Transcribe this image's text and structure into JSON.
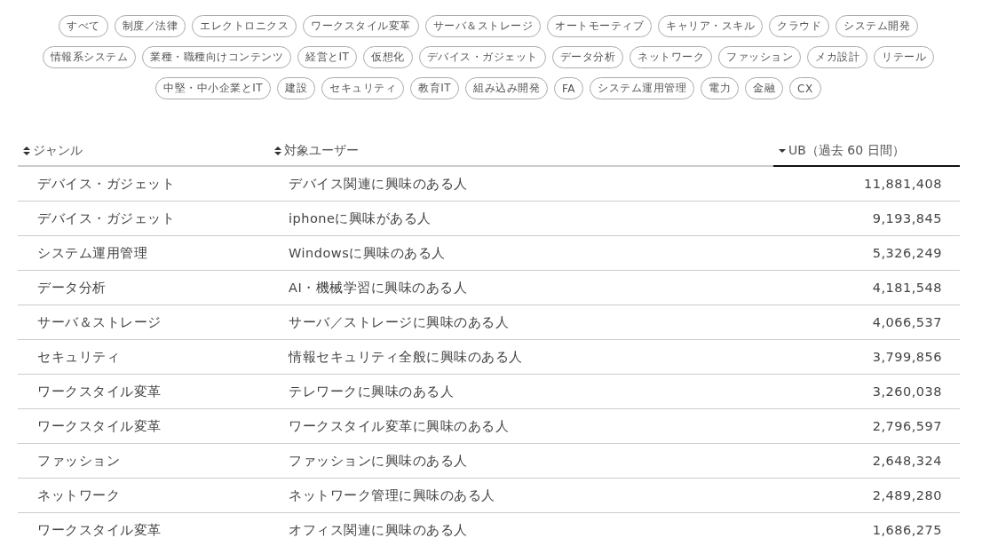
{
  "tag_rows": [
    [
      "すべて",
      "制度／法律",
      "エレクトロニクス",
      "ワークスタイル変革",
      "サーバ＆ストレージ",
      "オートモーティブ",
      "キャリア・スキル",
      "クラウド",
      "システム開発"
    ],
    [
      "情報系システム",
      "業種・職種向けコンテンツ",
      "経営とIT",
      "仮想化",
      "デバイス・ガジェット",
      "データ分析",
      "ネットワーク",
      "ファッション",
      "メカ設計",
      "リテール"
    ],
    [
      "中堅・中小企業とIT",
      "建設",
      "セキュリティ",
      "教育IT",
      "組み込み開発",
      "FA",
      "システム運用管理",
      "電力",
      "金融",
      "CX"
    ]
  ],
  "table": {
    "columns": [
      {
        "label": "ジャンル",
        "sorted": false
      },
      {
        "label": "対象ユーザー",
        "sorted": false
      },
      {
        "label": "UB（過去 60 日間）",
        "sorted": true
      }
    ],
    "rows": [
      [
        "デバイス・ガジェット",
        "デバイス関連に興味のある人",
        "11,881,408"
      ],
      [
        "デバイス・ガジェット",
        "iphoneに興味がある人",
        "9,193,845"
      ],
      [
        "システム運用管理",
        "Windowsに興味のある人",
        "5,326,249"
      ],
      [
        "データ分析",
        "AI・機械学習に興味のある人",
        "4,181,548"
      ],
      [
        "サーバ＆ストレージ",
        "サーバ／ストレージに興味のある人",
        "4,066,537"
      ],
      [
        "セキュリティ",
        "情報セキュリティ全般に興味のある人",
        "3,799,856"
      ],
      [
        "ワークスタイル変革",
        "テレワークに興味のある人",
        "3,260,038"
      ],
      [
        "ワークスタイル変革",
        "ワークスタイル変革に興味のある人",
        "2,796,597"
      ],
      [
        "ファッション",
        "ファッションに興味のある人",
        "2,648,324"
      ],
      [
        "ネットワーク",
        "ネットワーク管理に興味のある人",
        "2,489,280"
      ],
      [
        "ワークスタイル変革",
        "オフィス関連に興味のある人",
        "1,686,275"
      ]
    ]
  }
}
